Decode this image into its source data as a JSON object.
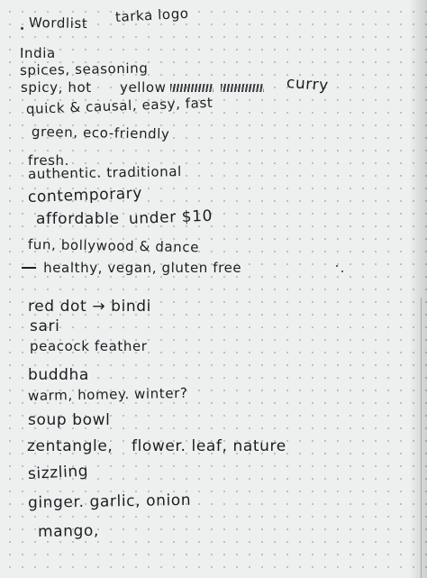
{
  "notes": {
    "title": "Wordlist",
    "title_note": "tarka logo",
    "lines": [
      "India",
      "spices, seasoning",
      "spicy, hot",
      "yellow",
      "curry",
      "quick & causal, easy, fast",
      "green, eco-friendly",
      "fresh.",
      "authentic. traditional",
      "contemporary",
      "affordable",
      "under $10",
      "fun, bollywood & dance",
      "healthy, vegan, gluten free",
      "red dot → bindi",
      "sari",
      "peacock feather",
      "buddha",
      "warm, homey. winter?",
      "soup bowl",
      "zentangle,",
      "flower. leaf, nature",
      "sizzling",
      "ginger. garlic, onion",
      "mango,"
    ]
  }
}
